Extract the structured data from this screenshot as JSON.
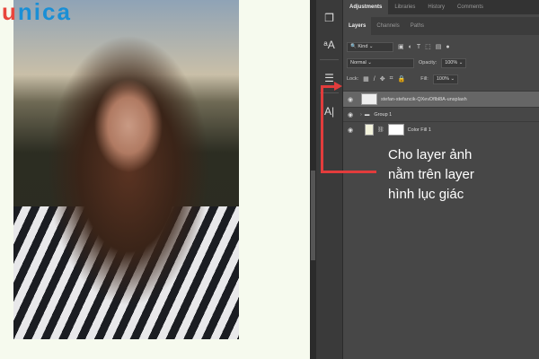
{
  "logo": {
    "u": "u",
    "rest": "nica"
  },
  "panel": {
    "tabs": [
      "Adjustments",
      "Libraries",
      "History",
      "Comments"
    ],
    "subtabs": [
      "Layers",
      "Channels",
      "Paths"
    ],
    "filter": "Kind",
    "blend_mode": "Normal",
    "opacity_label": "Opacity:",
    "opacity": "100%",
    "lock_label": "Lock:",
    "fill_label": "Fill:",
    "fill": "100%",
    "layers": [
      {
        "name": "stefan-stefancik-QXevDflbl8A-unsplash"
      },
      {
        "name": "Group 1"
      },
      {
        "name": "Color Fill 1"
      }
    ]
  },
  "annotation": {
    "line1": "Cho layer ảnh",
    "line2": "nằm trên layer",
    "line3": "hình lục giác"
  },
  "colors": {
    "accent": "#e23c3c",
    "logo_blue": "#1a8fd6"
  }
}
